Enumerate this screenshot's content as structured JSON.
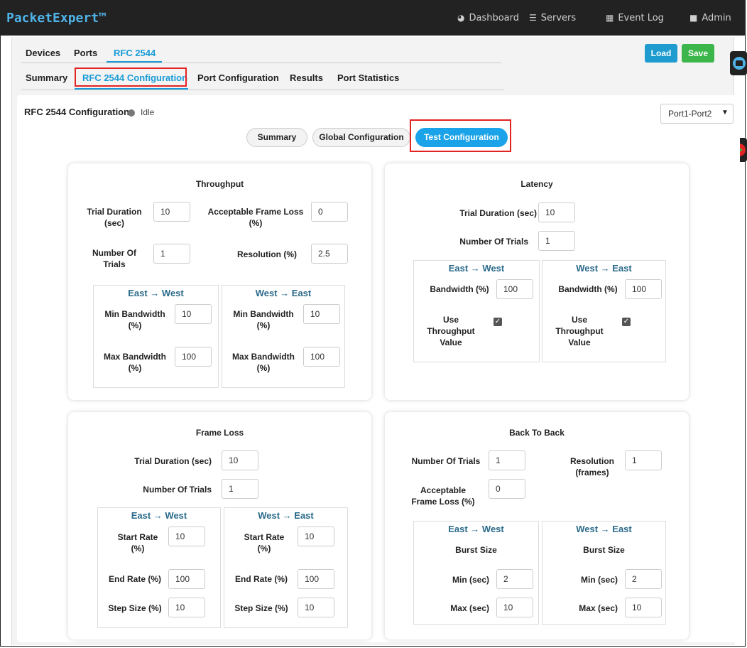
{
  "app": {
    "brand": "PacketExpert™",
    "nav": [
      {
        "label": "Dashboard",
        "icon": "dashboard-icon",
        "glyph": "◕"
      },
      {
        "label": "Servers",
        "icon": "servers-icon",
        "glyph": "☰"
      },
      {
        "label": "Event Log",
        "icon": "calendar-icon",
        "glyph": "▦"
      },
      {
        "label": "Admin",
        "icon": "user-icon",
        "glyph": "■"
      }
    ]
  },
  "tabs_primary": [
    "Devices",
    "Ports",
    "RFC 2544"
  ],
  "tabs_secondary": [
    "Summary",
    "RFC 2544 Configuration",
    "Port Configuration",
    "Results",
    "Port Statistics"
  ],
  "actions": {
    "load": "Load",
    "save": "Save"
  },
  "page": {
    "title": "RFC 2544 Configuration",
    "status": "Idle",
    "port_select": "Port1-Port2"
  },
  "subtabs": [
    "Summary",
    "Global Configuration",
    "Test Configuration"
  ],
  "throughput": {
    "title": "Throughput",
    "trial_duration_label": "Trial Duration (sec)",
    "trial_duration": "10",
    "frame_loss_label": "Acceptable Frame Loss (%)",
    "frame_loss": "0",
    "num_trials_label": "Number Of Trials",
    "num_trials": "1",
    "resolution_label": "Resolution (%)",
    "resolution": "2.5",
    "ew": {
      "title": "East → West",
      "min_label": "Min Bandwidth (%)",
      "min": "10",
      "max_label": "Max Bandwidth (%)",
      "max": "100"
    },
    "we": {
      "title": "West → East",
      "min_label": "Min Bandwidth (%)",
      "min": "10",
      "max_label": "Max Bandwidth (%)",
      "max": "100"
    }
  },
  "latency": {
    "title": "Latency",
    "trial_duration_label": "Trial Duration (sec)",
    "trial_duration": "10",
    "num_trials_label": "Number Of Trials",
    "num_trials": "1",
    "ew": {
      "title": "East → West",
      "bandwidth_label": "Bandwidth (%)",
      "bandwidth": "100",
      "use_label": "Use Throughput Value",
      "use_checked": true
    },
    "we": {
      "title": "West → East",
      "bandwidth_label": "Bandwidth (%)",
      "bandwidth": "100",
      "use_label": "Use Throughput Value",
      "use_checked": true
    }
  },
  "frameloss": {
    "title": "Frame Loss",
    "trial_duration_label": "Trial Duration (sec)",
    "trial_duration": "10",
    "num_trials_label": "Number Of Trials",
    "num_trials": "1",
    "ew": {
      "title": "East → West",
      "start_label": "Start Rate (%)",
      "start": "10",
      "end_label": "End Rate (%)",
      "end": "100",
      "step_label": "Step Size (%)",
      "step": "10"
    },
    "we": {
      "title": "West → East",
      "start_label": "Start Rate (%)",
      "start": "10",
      "end_label": "End Rate (%)",
      "end": "100",
      "step_label": "Step Size (%)",
      "step": "10"
    }
  },
  "backtoback": {
    "title": "Back To Back",
    "num_trials_label": "Number Of Trials",
    "num_trials": "1",
    "resolution_label": "Resolution (frames)",
    "resolution": "1",
    "frame_loss_label": "Acceptable Frame Loss (%)",
    "frame_loss": "0",
    "ew": {
      "title": "East → West",
      "burst_label": "Burst Size",
      "min_label": "Min (sec)",
      "min": "2",
      "max_label": "Max (sec)",
      "max": "10"
    },
    "we": {
      "title": "West → East",
      "burst_label": "Burst Size",
      "min_label": "Min (sec)",
      "min": "2",
      "max_label": "Max (sec)",
      "max": "10"
    }
  },
  "colors": {
    "accent": "#1a9bd7",
    "load": "#1e9ccf",
    "save": "#3cb54a",
    "highlight": "#e32222",
    "topbar": "#222222"
  }
}
